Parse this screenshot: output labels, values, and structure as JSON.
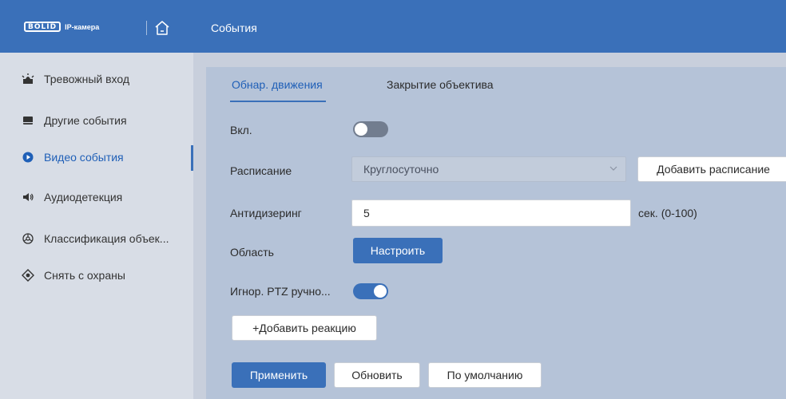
{
  "header": {
    "logo_brand": "BOLID",
    "logo_sub": "IP-камера",
    "title": "События"
  },
  "sidebar": {
    "items": [
      {
        "label": "Тревожный вход",
        "icon": "alarm-input-icon"
      },
      {
        "label": "Другие события",
        "icon": "other-events-icon"
      },
      {
        "label": "Видео события",
        "icon": "video-events-icon",
        "active": true
      },
      {
        "label": "Аудиодетекция",
        "icon": "speaker-icon"
      },
      {
        "label": "Классификация объек...",
        "icon": "classification-icon"
      },
      {
        "label": "Снять с охраны",
        "icon": "disarm-icon"
      }
    ]
  },
  "tabs": [
    {
      "label": "Обнар. движения",
      "active": true
    },
    {
      "label": "Закрытие объектива",
      "active": false
    }
  ],
  "form": {
    "enable_label": "Вкл.",
    "enable_state": "off",
    "schedule_label": "Расписание",
    "schedule_value": "Круглосуточно",
    "add_schedule_button": "Добавить расписание",
    "antidither_label": "Антидизеринг",
    "antidither_value": "5",
    "antidither_unit": "сек. (0-100)",
    "area_label": "Область",
    "configure_button": "Настроить",
    "ignore_ptz_label": "Игнор. PTZ ручно...",
    "ignore_ptz_state": "on",
    "add_reaction_button": "+Добавить реакцию"
  },
  "actions": {
    "apply": "Применить",
    "refresh": "Обновить",
    "default": "По умолчанию"
  },
  "colors": {
    "accent": "#3a70b9",
    "header": "#3a70b9",
    "sidebar_bg": "#d8dde6",
    "content_bg": "#b5c3d8"
  }
}
